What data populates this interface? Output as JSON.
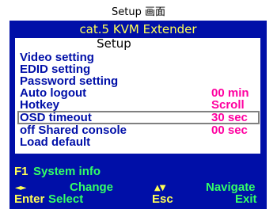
{
  "caption": "Setup 画面",
  "osd": {
    "title": "cat.5 KVM Extender",
    "menu_heading": "Setup",
    "items": [
      {
        "label": "Video setting",
        "value": ""
      },
      {
        "label": "EDID setting",
        "value": ""
      },
      {
        "label": "Password setting",
        "value": ""
      },
      {
        "label": "Auto logout",
        "value": "00  min"
      },
      {
        "label": "Hotkey",
        "value": "Scroll"
      },
      {
        "label": "OSD timeout",
        "value": "30  sec"
      },
      {
        "label": "off Shared console",
        "value": "00  sec"
      },
      {
        "label": "Load default",
        "value": ""
      }
    ],
    "selected_index": 5,
    "footer": {
      "f1_key": "F1",
      "f1_label": "System info",
      "lr_arrows": "◄►",
      "change_label": "Change",
      "ud_arrows": "▲▼",
      "navigate_label": "Navigate",
      "enter_key": "Enter",
      "select_label": "Select",
      "esc_key": "Esc",
      "exit_label": "Exit"
    }
  },
  "colors": {
    "osd_background": "#000fa8",
    "title_text": "#ffff55",
    "item_text": "#000fa8",
    "value_text": "#ff00a0",
    "key_text": "#ffff55",
    "action_text": "#33ff66",
    "selection_border": "#808080"
  }
}
